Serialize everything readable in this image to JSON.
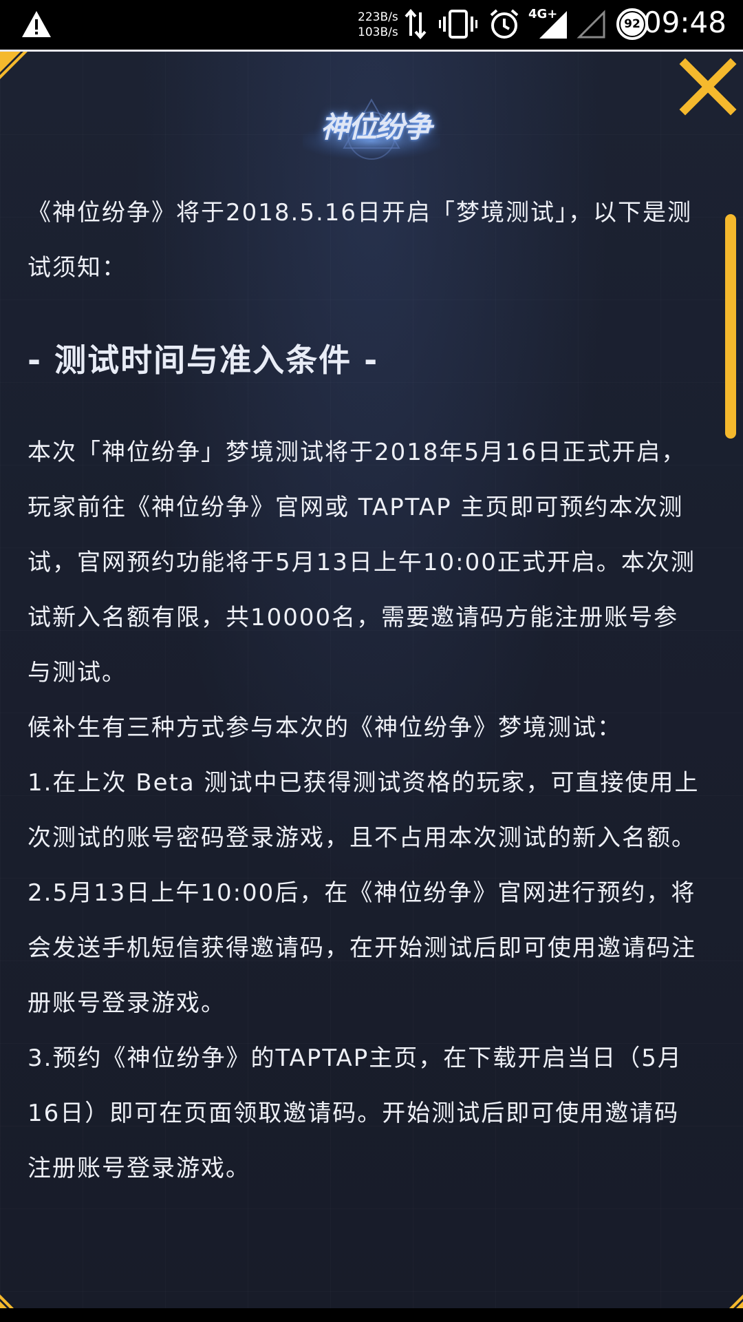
{
  "status_bar": {
    "speed_up": "223B/s",
    "speed_down": "103B/s",
    "network": "4G+",
    "battery": "92",
    "time": "09:48",
    "icons": [
      "warning-icon",
      "data-transfer-icon",
      "vibrate-icon",
      "alarm-icon",
      "signal-icon",
      "signal-empty-icon",
      "battery-icon"
    ]
  },
  "panel": {
    "logo_text": "神位纷争",
    "close_icon": "close-icon",
    "accent_color": "#f5b92d"
  },
  "content": {
    "intro": "《神位纷争》将于2018.5.16日开启「梦境测试」，以下是测试须知：",
    "heading": "- 测试时间与准入条件 -",
    "paragraphs": [
      "本次「神位纷争」梦境测试将于2018年5月16日正式开启，玩家前往《神位纷争》官网或 TAPTAP 主页即可预约本次测试，官网预约功能将于5月13日上午10:00正式开启。本次测试新入名额有限，共10000名，需要邀请码方能注册账号参与测试。",
      "候补生有三种方式参与本次的《神位纷争》梦境测试：",
      "1.在上次 Beta 测试中已获得测试资格的玩家，可直接使用上次测试的账号密码登录游戏，且不占用本次测试的新入名额。",
      "2.5月13日上午10:00后，在《神位纷争》官网进行预约，将会发送手机短信获得邀请码，在开始测试后即可使用邀请码注册账号登录游戏。",
      "3.预约《神位纷争》的TAPTAP主页，在下载开启当日（5月16日）即可在页面领取邀请码。开始测试后即可使用邀请码注册账号登录游戏。"
    ]
  }
}
